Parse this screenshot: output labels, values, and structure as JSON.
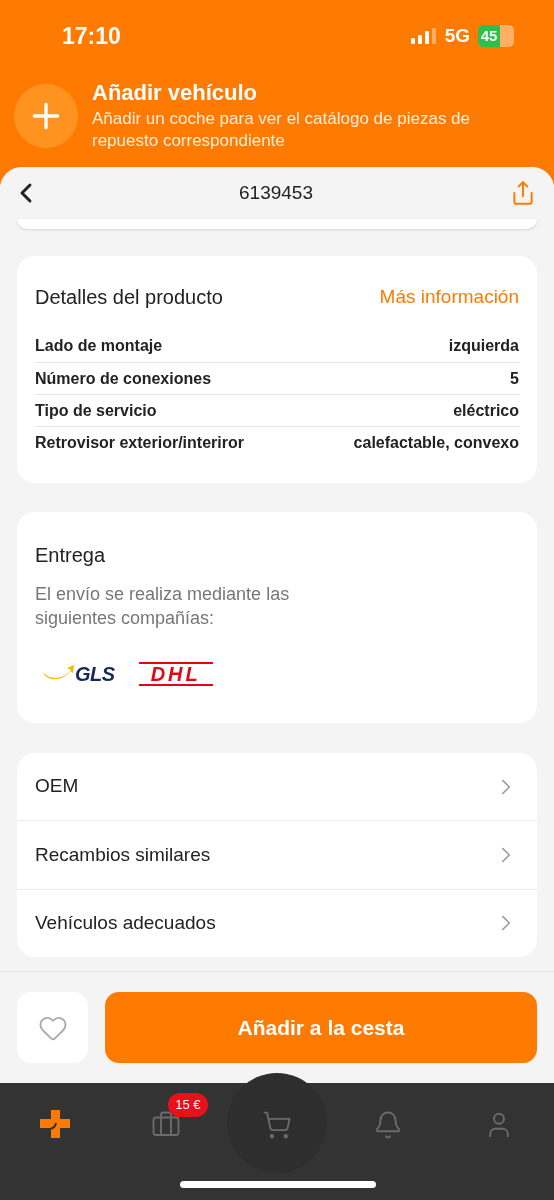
{
  "status_bar": {
    "time": "17:10",
    "network": "5G",
    "battery": "45"
  },
  "banner": {
    "title": "Añadir vehículo",
    "subtitle": "Añadir un coche para ver el catálogo de piezas de repuesto correspondiente"
  },
  "nav": {
    "title": "6139453"
  },
  "details": {
    "title": "Detalles del producto",
    "link": "Más información",
    "rows": [
      {
        "label": "Lado de montaje",
        "value": "izquierda"
      },
      {
        "label": "Número de conexiones",
        "value": "5"
      },
      {
        "label": "Tipo de servicio",
        "value": "eléctrico"
      },
      {
        "label": "Retrovisor exterior/interiror",
        "value": "calefactable, convexo"
      }
    ]
  },
  "delivery": {
    "title": "Entrega",
    "text": "El envío se realiza mediante las siguientes compañías:",
    "carriers": [
      {
        "kind": "gls",
        "name": "GLS"
      },
      {
        "kind": "dhl",
        "name": "DHL"
      }
    ]
  },
  "links": [
    "OEM",
    "Recambios similares",
    "Vehículos adecuados"
  ],
  "cart_button": "Añadir a la cesta",
  "tab_bar": [
    {
      "kind": "home",
      "selected": true
    },
    {
      "kind": "wallet",
      "selected": false,
      "badge": "15 €"
    },
    {
      "kind": "cart",
      "selected": false
    },
    {
      "kind": "bell",
      "selected": false
    },
    {
      "kind": "profile",
      "selected": false
    }
  ]
}
